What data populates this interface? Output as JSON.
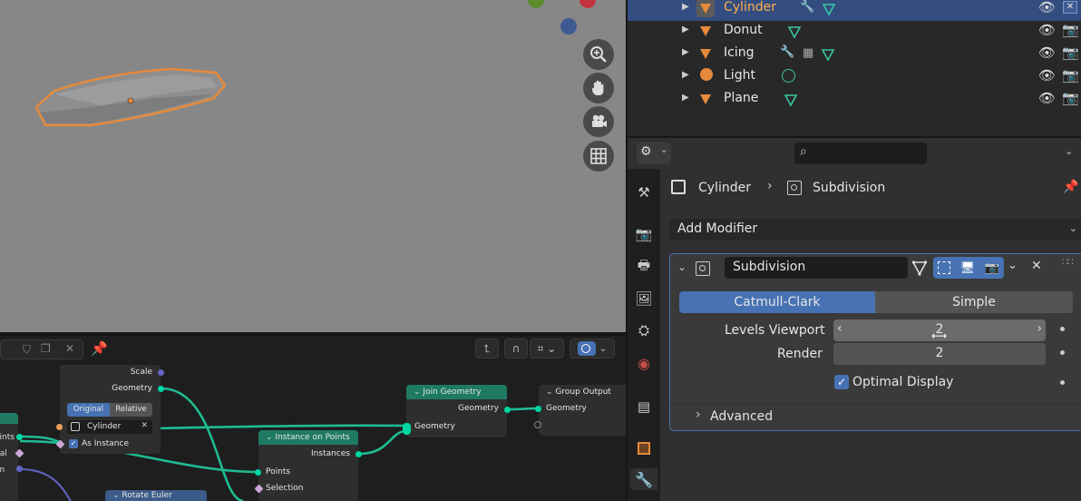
{
  "outliner": {
    "items": [
      {
        "label": "Cylinder",
        "selected": true
      },
      {
        "label": "Donut",
        "selected": false
      },
      {
        "label": "Icing",
        "selected": false
      },
      {
        "label": "Light",
        "selected": false
      },
      {
        "label": "Plane",
        "selected": false
      }
    ]
  },
  "properties": {
    "breadcrumb": {
      "object": "Cylinder",
      "modifier": "Subdivision"
    },
    "add_modifier_label": "Add Modifier",
    "modifier": {
      "name": "Subdivision",
      "modes": [
        "Catmull-Clark",
        "Simple"
      ],
      "active_mode": "Catmull-Clark",
      "levels_viewport_label": "Levels Viewport",
      "levels_viewport_value": "2",
      "render_label": "Render",
      "render_value": "2",
      "optimal_display_label": "Optimal Display",
      "optimal_display_checked": true,
      "advanced_label": "Advanced"
    }
  },
  "node_editor": {
    "object_info": {
      "scale": "Scale",
      "geometry": "Geometry",
      "original": "Original",
      "relative": "Relative",
      "object": "Cylinder",
      "as_instance": "As Instance"
    },
    "join_geometry": {
      "title": "Join Geometry",
      "out": "Geometry",
      "in": "Geometry"
    },
    "group_output": {
      "title": "Group Output",
      "in": "Geometry"
    },
    "instance_on_points": {
      "title": "Instance on Points",
      "instances": "Instances",
      "points": "Points",
      "selection": "Selection"
    },
    "rotate_euler": {
      "title": "Rotate Euler"
    },
    "left_labels": [
      "oints",
      "nal",
      "on"
    ]
  },
  "colors": {
    "accent": "#4772b3",
    "selection": "#334d80",
    "object_orange": "#e68a3b",
    "geometry_socket": "#00d6a3",
    "node_header_green": "#1f7a63"
  }
}
